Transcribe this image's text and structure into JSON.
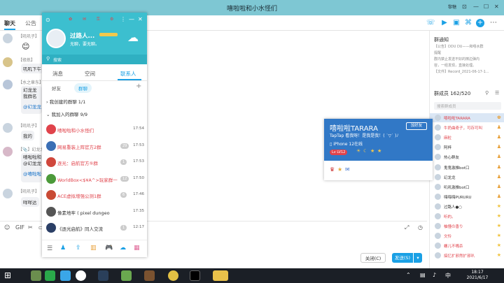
{
  "window": {
    "title": "嘻啦啦和小水怪们",
    "user_menu": "黎糖"
  },
  "tabs": {
    "chat": "聊天",
    "notice": "公告"
  },
  "chat": {
    "items": [
      {
        "nick": "【叽叽子】",
        "text": "😊"
      },
      {
        "nick": "【修炼】",
        "text": "叽叽下午"
      },
      {
        "nick": "【水之章东】",
        "text": "幻龙龙"
      },
      {
        "nick": "",
        "text": "我群名"
      },
      {
        "nick": "",
        "text": "@幻龙龙"
      },
      {
        "nick": "【叽叽子】",
        "text": "我的"
      },
      {
        "nick": "【📎】幻龙龙",
        "text": "嘻啦啦和"
      },
      {
        "nick": "",
        "text": "@幻龙龙"
      },
      {
        "nick": "",
        "text": "@嘻啦啦"
      },
      {
        "nick": "【叽叽子】",
        "text": "咩咩达"
      }
    ]
  },
  "qq": {
    "username": "过路人...",
    "signature": "无聊，要无聊。",
    "search_placeholder": "搜索",
    "tabs": [
      "消息",
      "空间",
      "联系人"
    ],
    "subtabs": [
      "好友",
      "群聊"
    ],
    "sections": [
      {
        "label": "我创建的群聊",
        "count": "1/1"
      },
      {
        "label": "我加入的群聊",
        "count": "9/9"
      }
    ],
    "groups": [
      {
        "name": "嘻啦啦和小水怪们",
        "time": "17:54",
        "badge": "",
        "color": "#e0434b",
        "name_color": "#e0434b"
      },
      {
        "name": "网易重装上阵官方2群",
        "time": "17:53",
        "badge": "29",
        "color": "#3b6fb5",
        "name_color": "#e0434b"
      },
      {
        "name": "逐光：启航官方⑤群",
        "time": "17:53",
        "badge": "1",
        "color": "#d0473c",
        "name_color": "#e0434b"
      },
      {
        "name": "WorldBox<$¥A^>玩家群一",
        "time": "17:50",
        "badge": "12",
        "color": "#4c9a3a",
        "name_color": "#e0434b"
      },
      {
        "name": "ACE虚拟增强公测1群",
        "time": "17:46",
        "badge": "6",
        "color": "#c94a34",
        "name_color": "#e0434b"
      },
      {
        "name": "像素地牢 ( pixel dungeo",
        "time": "17:35",
        "badge": "",
        "color": "#555555",
        "name_color": "#333333"
      },
      {
        "name": "《逐光启航》同人交流",
        "time": "12:17",
        "badge": "1",
        "color": "#2b3f66",
        "name_color": "#333333"
      }
    ]
  },
  "popup": {
    "name": "嘻啦啦TARARA",
    "add_friend": "加好友",
    "tags": "TapTap 看我呀！是我是我！( ˙▽˙ )ﾉ",
    "device": "iPhone 12在线",
    "level_badge": "Lv LV12"
  },
  "rightpane": {
    "announce_title": "群通知",
    "announce_items": [
      "【公告】DDU DU——和嘻水群",
      "提醒",
      "群内禁止发送不好的擦边弹内",
      "容，一经发现，直接处理。",
      "【文件】Record_2021-06-17-1..."
    ],
    "member_title": "群成员 162/520",
    "member_search": "搜索群成员",
    "members": [
      {
        "name": "嘻啦啦TARARA",
        "color": "#e0434b",
        "role": "owner"
      },
      {
        "name": "牛奶曲奇子，可存可叫",
        "color": "#e0434b",
        "role": "admin"
      },
      {
        "name": "麻粒",
        "color": "#e0434b",
        "role": "admin"
      },
      {
        "name": "阿梓",
        "color": "#333333",
        "role": "admin"
      },
      {
        "name": "热心群友",
        "color": "#333333",
        "role": "admin"
      },
      {
        "name": "鬼鬼激推bot口",
        "color": "#333333",
        "role": "admin"
      },
      {
        "name": "幻龙龙",
        "color": "#333333",
        "role": "admin"
      },
      {
        "name": "叽叽激推bot口",
        "color": "#333333",
        "role": "admin"
      },
      {
        "name": "嗨嗨嗨PURURU",
        "color": "#333333",
        "role": "admin"
      },
      {
        "name": "过路人●○",
        "color": "#333333",
        "role": "member"
      },
      {
        "name": "听的。",
        "color": "#e0434b",
        "role": "member"
      },
      {
        "name": "柚懂の香り",
        "color": "#e0434b",
        "role": "member"
      },
      {
        "name": "文怜",
        "color": "#e0434b",
        "role": "member"
      },
      {
        "name": "螺儿不嘴杀",
        "color": "#e0434b",
        "role": "member"
      },
      {
        "name": "搞忆扩邪然扩邪叭",
        "color": "#e0434b",
        "role": "member"
      }
    ]
  },
  "input": {
    "close_label": "关闭(C)",
    "send_label": "发送(S)"
  },
  "taskbar": {
    "time": "18:17",
    "date": "2021/6/17"
  },
  "colors": {
    "accent": "#1aa0e5",
    "titlebar": "#7ec7d3",
    "qq_head": "#3cbfcf",
    "popup_head": "#3178c6",
    "send": "#1aa0e5"
  }
}
